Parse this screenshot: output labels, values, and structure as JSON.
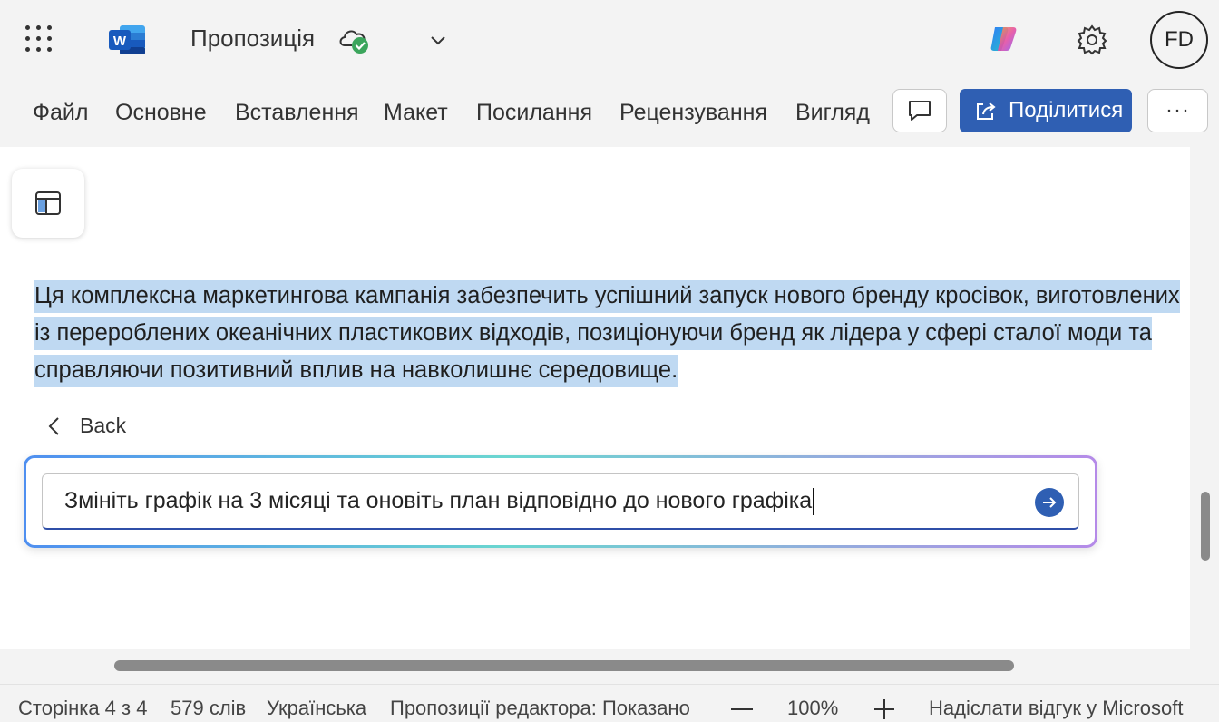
{
  "app": {
    "name": "Word",
    "document_title": "Пропозиція",
    "user_initials": "FD",
    "colors": {
      "accent": "#2f5fb3",
      "selection": "#bfd9f2",
      "word_blue": "#185abd",
      "cloud_ok": "#3ba55c"
    }
  },
  "titlebar": {
    "icons": [
      "app-launcher-icon",
      "word-logo-icon",
      "cloud-saved-icon",
      "chevron-down-icon",
      "copilot-icon",
      "gear-icon"
    ]
  },
  "ribbon": {
    "tabs": [
      "Файл",
      "Основне",
      "Вставлення",
      "Макет",
      "Посилання",
      "Рецензування",
      "Вигляд"
    ],
    "share_label": "Поділитися",
    "more_label": "···"
  },
  "document": {
    "selected_paragraph": "Ця комплексна маркетингова кампанія забезпечить успішний запуск нового бренду кросівок, виготовлених із перероблених океанічних пластикових відходів, позиціонуючи бренд як лідера у сфері сталої моди та справляючи позитивний вплив на навколишнє середовище.",
    "back_label": "Back",
    "prompt_value": "Змініть графік на 3 місяці та оновіть план відповідно до нового графіка"
  },
  "statusbar": {
    "page": "Сторінка 4 з 4",
    "words": "579 слів",
    "language": "Українська",
    "editor": "Пропозиції редактора: Показано",
    "zoom": "100%",
    "feedback": "Надіслати відгук у Microsoft"
  }
}
